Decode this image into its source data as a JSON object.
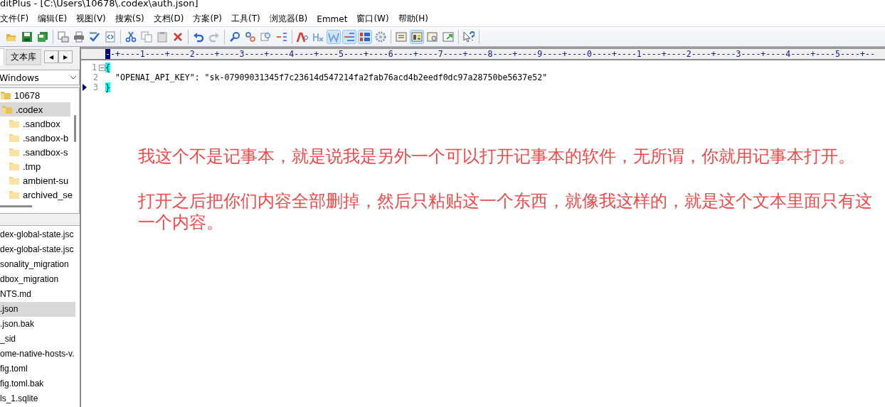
{
  "window": {
    "title": "ditPlus - [C:\\Users\\10678\\.codex\\auth.json]"
  },
  "menu": [
    "文件(F)",
    "编辑(E)",
    "视图(V)",
    "搜索(S)",
    "文档(D)",
    "方案(P)",
    "工具(T)",
    "浏览器(B)",
    "Emmet",
    "窗口(W)",
    "帮助(H)"
  ],
  "toolbar": [
    [
      {
        "kind": "open",
        "active": false
      },
      {
        "kind": "save",
        "active": false
      },
      {
        "kind": "save-all",
        "active": false
      }
    ],
    [
      {
        "kind": "preview",
        "active": false
      },
      {
        "kind": "print",
        "active": false
      },
      {
        "kind": "spell",
        "active": false
      },
      {
        "kind": "code",
        "active": false
      }
    ],
    [
      {
        "kind": "cut",
        "active": false
      },
      {
        "kind": "copy",
        "active": false
      },
      {
        "kind": "paste",
        "active": false
      },
      {
        "kind": "delete",
        "active": false
      }
    ],
    [
      {
        "kind": "undo",
        "active": false
      },
      {
        "kind": "redo",
        "active": false
      }
    ],
    [
      {
        "kind": "find",
        "active": false
      },
      {
        "kind": "replace",
        "active": false
      },
      {
        "kind": "goto",
        "active": false
      },
      {
        "kind": "indent",
        "active": false
      }
    ],
    [
      {
        "kind": "font",
        "active": false
      },
      {
        "kind": "heading",
        "active": false
      },
      {
        "kind": "wrap",
        "active": true
      },
      {
        "kind": "lines",
        "active": true
      },
      {
        "kind": "numbers",
        "active": true
      },
      {
        "kind": "gear",
        "active": false
      }
    ],
    [
      {
        "kind": "list",
        "active": false
      },
      {
        "kind": "panel",
        "active": true
      },
      {
        "kind": "search-doc",
        "active": false
      },
      {
        "kind": "window",
        "active": false
      }
    ],
    [
      {
        "kind": "help",
        "active": false
      }
    ]
  ],
  "sidebar": {
    "tabs": [
      {
        "selected": true
      },
      {
        "label": "文本库",
        "selected": false
      }
    ],
    "arrows": [
      "◀",
      "▶"
    ],
    "drive": "Windows",
    "tree": [
      {
        "name": "10678",
        "selected": false,
        "children": [
          {
            "name": ".codex",
            "selected": true,
            "children": [
              {
                "name": ".sandbox",
                "selected": false
              },
              {
                "name": ".sandbox-b",
                "selected": false
              },
              {
                "name": ".sandbox-s",
                "selected": false
              },
              {
                "name": ".tmp",
                "selected": false
              },
              {
                "name": "ambient-su",
                "selected": false
              },
              {
                "name": "archived_se",
                "selected": false
              }
            ]
          }
        ]
      }
    ],
    "files": [
      {
        "name": "dex-global-state.jsc",
        "selected": false
      },
      {
        "name": "dex-global-state.jsc",
        "selected": false
      },
      {
        "name": "sonality_migration",
        "selected": false
      },
      {
        "name": "dbox_migration",
        "selected": false
      },
      {
        "name": "NTS.md",
        "selected": false
      },
      {
        "name": ".json",
        "selected": true
      },
      {
        "name": ".json.bak",
        "selected": false
      },
      {
        "name": "_sid",
        "selected": false
      },
      {
        "name": "ome-native-hosts-v.",
        "selected": false
      },
      {
        "name": "fig.toml",
        "selected": false
      },
      {
        "name": "fig.toml.bak",
        "selected": false
      },
      {
        "name": "ls_1.sqlite",
        "selected": false
      }
    ]
  },
  "editor": {
    "ruler_cursor": "-",
    "ruler": "-+----1----+----2----+----3----+----4----+----5----+----6----+----7----+----8----+----9----+----0----+----1----+----2----+----3----+----4----+----5----+--",
    "lines": [
      {
        "number": "1",
        "text": "{",
        "fold": true,
        "current": false,
        "brace_match": true
      },
      {
        "number": "2",
        "text": "  \"OPENAI_API_KEY\": \"sk-07909031345f7c23614d547214fa2fab76acd4b2eedf0dc97a28750be5637e52\"",
        "fold": false,
        "current": false,
        "brace_match": false
      },
      {
        "number": "3",
        "text": "}",
        "fold": false,
        "current": true,
        "brace_match": true
      }
    ],
    "annotations": [
      "我这个不是记事本，就是说我是另外一个可以打开记事本的软件，无所谓，你就用记事本打开。",
      "打开之后把你们内容全部删掉，然后只粘贴这一个东西，就像我这样的，就是这个文本里面只有这一个内容。"
    ]
  }
}
